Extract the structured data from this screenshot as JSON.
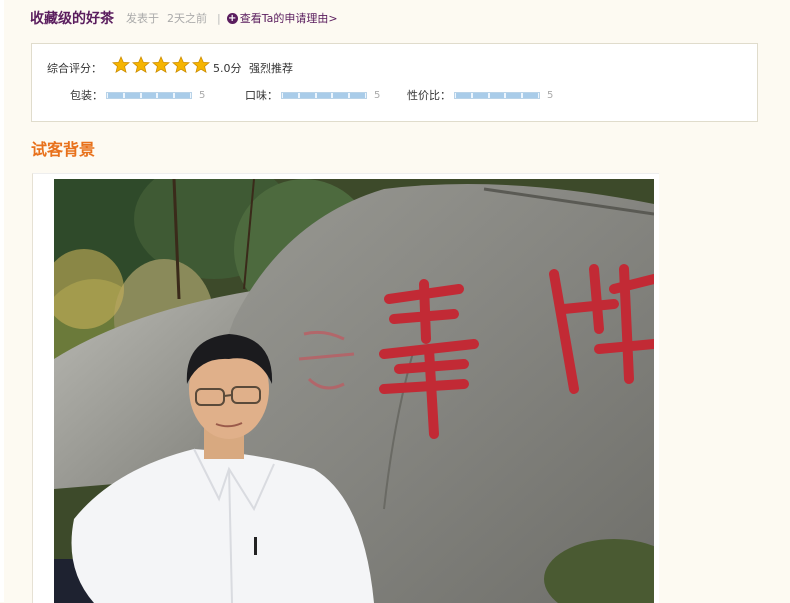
{
  "post": {
    "title": "收藏级的好茶",
    "posted_label": "发表于",
    "posted_time": "2天之前",
    "separator": "|",
    "reason_link": "查看Ta的申请理由>"
  },
  "rating": {
    "overall_label": "综合评分：",
    "stars_filled": 5,
    "stars_total": 5,
    "score": "5.0分",
    "recommendation": "强烈推荐",
    "sub_ratings": [
      {
        "label": "包装：",
        "score": "5"
      },
      {
        "label": "口味：",
        "score": "5"
      },
      {
        "label": "性价比：",
        "score": "5"
      }
    ]
  },
  "section": {
    "title": "试客背景"
  },
  "photo": {
    "icon": "photo-of-man-sitting-in-front-of-carved-rock"
  },
  "colors": {
    "title": "#5a1d5e",
    "section_title": "#e8711c",
    "star": "#f5b400",
    "bar": "#a9cce9",
    "background": "#fdfaf2"
  }
}
